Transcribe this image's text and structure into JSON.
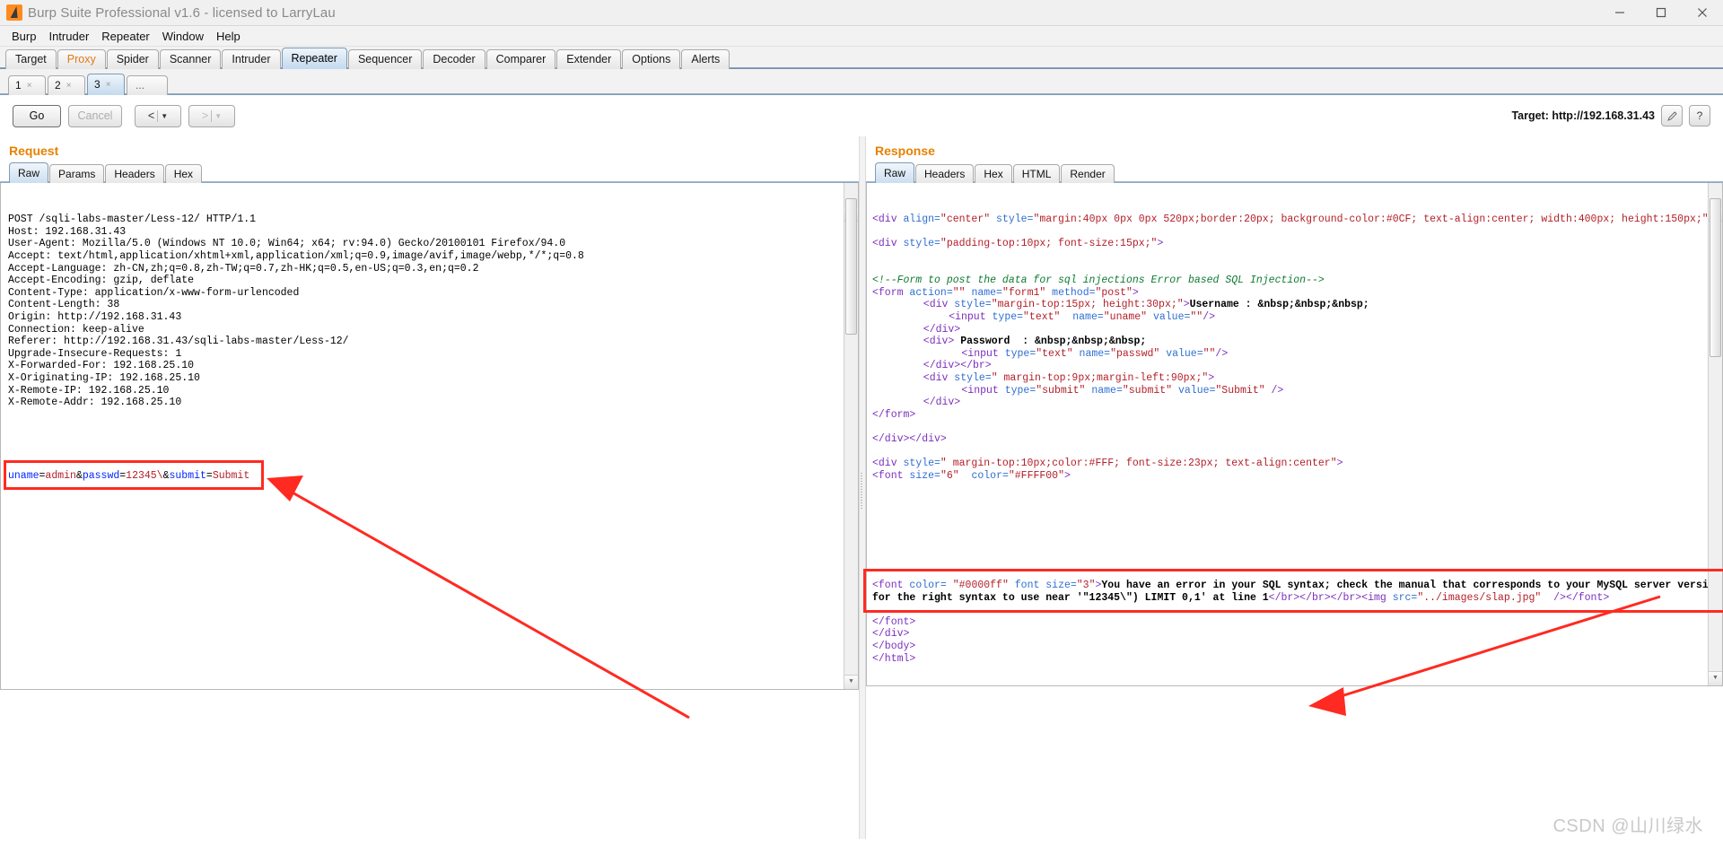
{
  "window": {
    "title": "Burp Suite Professional v1.6 - licensed to LarryLau",
    "icon": "burp-logo-icon",
    "controls": {
      "minimize": "—",
      "maximize": "❐",
      "close": "✕"
    }
  },
  "menubar": {
    "items": [
      "Burp",
      "Intruder",
      "Repeater",
      "Window",
      "Help"
    ]
  },
  "main_tabs": {
    "items": [
      {
        "label": "Target",
        "state": "normal"
      },
      {
        "label": "Proxy",
        "state": "highlight"
      },
      {
        "label": "Spider",
        "state": "normal"
      },
      {
        "label": "Scanner",
        "state": "normal"
      },
      {
        "label": "Intruder",
        "state": "normal"
      },
      {
        "label": "Repeater",
        "state": "active"
      },
      {
        "label": "Sequencer",
        "state": "normal"
      },
      {
        "label": "Decoder",
        "state": "normal"
      },
      {
        "label": "Comparer",
        "state": "normal"
      },
      {
        "label": "Extender",
        "state": "normal"
      },
      {
        "label": "Options",
        "state": "normal"
      },
      {
        "label": "Alerts",
        "state": "normal"
      }
    ]
  },
  "repeater_tabs": {
    "items": [
      {
        "label": "1",
        "close": "×",
        "active": false
      },
      {
        "label": "2",
        "close": "×",
        "active": false
      },
      {
        "label": "3",
        "close": "×",
        "active": true
      }
    ],
    "more": "..."
  },
  "actionbar": {
    "go_label": "Go",
    "cancel_label": "Cancel",
    "back_label": "<",
    "back_caret": "▼",
    "forward_label": ">",
    "forward_caret": "▼",
    "target_label": "Target: http://192.168.31.43",
    "edit_icon": "pencil-icon",
    "help_icon": "question-mark-icon",
    "help_label": "?"
  },
  "request": {
    "title": "Request",
    "tabs": [
      {
        "label": "Raw",
        "active": true
      },
      {
        "label": "Params",
        "active": false
      },
      {
        "label": "Headers",
        "active": false
      },
      {
        "label": "Hex",
        "active": false
      }
    ],
    "lines": [
      "POST /sqli-labs-master/Less-12/ HTTP/1.1",
      "Host: 192.168.31.43",
      "User-Agent: Mozilla/5.0 (Windows NT 10.0; Win64; x64; rv:94.0) Gecko/20100101 Firefox/94.0",
      "Accept: text/html,application/xhtml+xml,application/xml;q=0.9,image/avif,image/webp,*/*;q=0.8",
      "Accept-Language: zh-CN,zh;q=0.8,zh-TW;q=0.7,zh-HK;q=0.5,en-US;q=0.3,en;q=0.2",
      "Accept-Encoding: gzip, deflate",
      "Content-Type: application/x-www-form-urlencoded",
      "Content-Length: 38",
      "Origin: http://192.168.31.43",
      "Connection: keep-alive",
      "Referer: http://192.168.31.43/sqli-labs-master/Less-12/",
      "Upgrade-Insecure-Requests: 1",
      "X-Forwarded-For: 192.168.25.10",
      "X-Originating-IP: 192.168.25.10",
      "X-Remote-IP: 192.168.25.10",
      "X-Remote-Addr: 192.168.25.10"
    ],
    "body_tokens": [
      {
        "t": "uname",
        "c": "key"
      },
      {
        "t": "=",
        "c": "plain"
      },
      {
        "t": "admin",
        "c": "val"
      },
      {
        "t": "&",
        "c": "plain"
      },
      {
        "t": "passwd",
        "c": "key"
      },
      {
        "t": "=",
        "c": "plain"
      },
      {
        "t": "12345\\",
        "c": "val"
      },
      {
        "t": "&",
        "c": "plain"
      },
      {
        "t": "submit",
        "c": "key"
      },
      {
        "t": "=",
        "c": "plain"
      },
      {
        "t": "Submit",
        "c": "val"
      }
    ],
    "body_plain": "uname=admin&passwd=12345\\&submit=Submit"
  },
  "response": {
    "title": "Response",
    "tabs": [
      {
        "label": "Raw",
        "active": true
      },
      {
        "label": "Headers",
        "active": false
      },
      {
        "label": "Hex",
        "active": false
      },
      {
        "label": "HTML",
        "active": false
      },
      {
        "label": "Render",
        "active": false
      }
    ],
    "blocks": [
      {
        "id": "div-outer",
        "segments": [
          {
            "t": "<div",
            "c": "tag"
          },
          {
            "t": " align=",
            "c": "attr"
          },
          {
            "t": "\"center\"",
            "c": "val"
          },
          {
            "t": " style=",
            "c": "attr"
          },
          {
            "t": "\"margin:40px 0px 0px 520px;border:20px; background-color:#0CF; text-align:center; width:400px; height:150px;\"",
            "c": "val"
          },
          {
            "t": ">",
            "c": "tag"
          }
        ]
      },
      {
        "id": "div-padding",
        "segments": [
          {
            "t": "<div",
            "c": "tag"
          },
          {
            "t": " style=",
            "c": "attr"
          },
          {
            "t": "\"padding-top:10px; font-size:15px;\"",
            "c": "val"
          },
          {
            "t": ">",
            "c": "tag"
          }
        ]
      },
      {
        "id": "comment",
        "segments": [
          {
            "t": "<!--Form to post the data for sql injections Error based SQL Injection-->",
            "c": "comment"
          }
        ]
      },
      {
        "id": "form-open",
        "segments": [
          {
            "t": "<form",
            "c": "tag"
          },
          {
            "t": " action=",
            "c": "attr"
          },
          {
            "t": "\"\"",
            "c": "val"
          },
          {
            "t": " name=",
            "c": "attr"
          },
          {
            "t": "\"form1\"",
            "c": "val"
          },
          {
            "t": " method=",
            "c": "attr"
          },
          {
            "t": "\"post\"",
            "c": "val"
          },
          {
            "t": ">",
            "c": "tag"
          }
        ]
      },
      {
        "id": "div-username",
        "indent": 8,
        "segments": [
          {
            "t": "<div",
            "c": "tag"
          },
          {
            "t": " style=",
            "c": "attr"
          },
          {
            "t": "\"margin-top:15px; height:30px;\"",
            "c": "val"
          },
          {
            "t": ">",
            "c": "tag"
          },
          {
            "t": "Username : &nbsp;&nbsp;&nbsp;",
            "c": "text"
          }
        ]
      },
      {
        "id": "input-uname",
        "indent": 12,
        "segments": [
          {
            "t": "<input",
            "c": "tag"
          },
          {
            "t": " type=",
            "c": "attr"
          },
          {
            "t": "\"text\"",
            "c": "val"
          },
          {
            "t": "  name=",
            "c": "attr"
          },
          {
            "t": "\"uname\"",
            "c": "val"
          },
          {
            "t": " value=",
            "c": "attr"
          },
          {
            "t": "\"\"",
            "c": "val"
          },
          {
            "t": "/>",
            "c": "tag"
          }
        ]
      },
      {
        "id": "div-close-1",
        "indent": 8,
        "segments": [
          {
            "t": "</div>",
            "c": "tag"
          }
        ]
      },
      {
        "id": "div-password",
        "indent": 8,
        "segments": [
          {
            "t": "<div>",
            "c": "tag"
          },
          {
            "t": " Password  : &nbsp;&nbsp;&nbsp;",
            "c": "text"
          }
        ]
      },
      {
        "id": "input-passwd",
        "indent": 14,
        "segments": [
          {
            "t": "<input",
            "c": "tag"
          },
          {
            "t": " type=",
            "c": "attr"
          },
          {
            "t": "\"text\"",
            "c": "val"
          },
          {
            "t": " name=",
            "c": "attr"
          },
          {
            "t": "\"passwd\"",
            "c": "val"
          },
          {
            "t": " value=",
            "c": "attr"
          },
          {
            "t": "\"\"",
            "c": "val"
          },
          {
            "t": "/>",
            "c": "tag"
          }
        ]
      },
      {
        "id": "div-close-2",
        "indent": 8,
        "segments": [
          {
            "t": "</div></br>",
            "c": "tag"
          }
        ]
      },
      {
        "id": "div-submit",
        "indent": 8,
        "segments": [
          {
            "t": "<div",
            "c": "tag"
          },
          {
            "t": " style=",
            "c": "attr"
          },
          {
            "t": "\" margin-top:9px;margin-left:90px;\"",
            "c": "val"
          },
          {
            "t": ">",
            "c": "tag"
          }
        ]
      },
      {
        "id": "input-submit",
        "indent": 14,
        "segments": [
          {
            "t": "<input",
            "c": "tag"
          },
          {
            "t": " type=",
            "c": "attr"
          },
          {
            "t": "\"submit\"",
            "c": "val"
          },
          {
            "t": " name=",
            "c": "attr"
          },
          {
            "t": "\"submit\"",
            "c": "val"
          },
          {
            "t": " value=",
            "c": "attr"
          },
          {
            "t": "\"Submit\"",
            "c": "val"
          },
          {
            "t": " />",
            "c": "tag"
          }
        ]
      },
      {
        "id": "div-close-3",
        "indent": 8,
        "segments": [
          {
            "t": "</div>",
            "c": "tag"
          }
        ]
      },
      {
        "id": "form-close",
        "segments": [
          {
            "t": "</form>",
            "c": "tag"
          }
        ]
      },
      {
        "id": "div-close-4",
        "segments": [
          {
            "t": "</div></div>",
            "c": "tag"
          }
        ]
      },
      {
        "id": "div-error-wrap",
        "segments": [
          {
            "t": "<div",
            "c": "tag"
          },
          {
            "t": " style=",
            "c": "attr"
          },
          {
            "t": "\" margin-top:10px;color:#FFF; font-size:23px; text-align:center\"",
            "c": "val"
          },
          {
            "t": ">",
            "c": "tag"
          }
        ]
      },
      {
        "id": "font-open",
        "segments": [
          {
            "t": "<font",
            "c": "tag"
          },
          {
            "t": " size=",
            "c": "attr"
          },
          {
            "t": "\"6\"",
            "c": "val"
          },
          {
            "t": "  color=",
            "c": "attr"
          },
          {
            "t": "\"#FFFF00\"",
            "c": "val"
          },
          {
            "t": ">",
            "c": "tag"
          }
        ]
      }
    ],
    "error_block": {
      "segments": [
        {
          "t": "<font",
          "c": "tag"
        },
        {
          "t": " color= ",
          "c": "attr"
        },
        {
          "t": "\"#0000ff\"",
          "c": "val"
        },
        {
          "t": " font size=",
          "c": "attr"
        },
        {
          "t": "\"3\"",
          "c": "val"
        },
        {
          "t": ">",
          "c": "tag"
        },
        {
          "t": "You have an error in your SQL syntax; check the manual that corresponds to your MySQL server version for the right syntax to use near '\"12345\\\") LIMIT 0,1' at line 1",
          "c": "text"
        },
        {
          "t": "</br></br></br><img",
          "c": "tag"
        },
        {
          "t": " src=",
          "c": "attr"
        },
        {
          "t": "\"../images/slap.jpg\"",
          "c": "val"
        },
        {
          "t": "  />",
          "c": "tag"
        },
        {
          "t": "</font>",
          "c": "tag"
        }
      ]
    },
    "closing_lines": [
      "</font>",
      "</div>",
      "</body>",
      "</html>"
    ]
  },
  "annotations": {
    "request_highlight": "uname=admin&passwd=12345\\&submit=Submit",
    "response_highlight": "SQL error message",
    "arrow_color": "#ff2a21"
  },
  "watermark": {
    "text": "CSDN @山川绿水"
  }
}
